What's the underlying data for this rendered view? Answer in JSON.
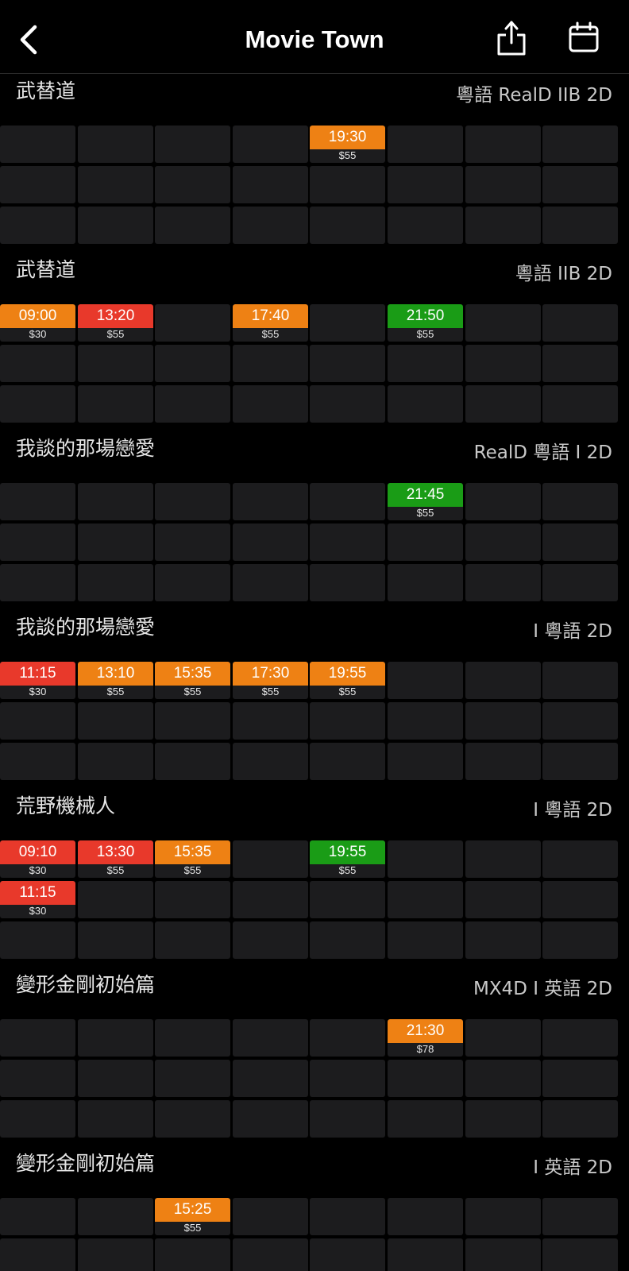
{
  "header": {
    "title": "Movie Town",
    "back_icon": "chevron-left-icon",
    "share_icon": "share-icon",
    "calendar_icon": "calendar-icon"
  },
  "colors": {
    "background": "#000000",
    "cell": "#1c1c1e",
    "orange": "#ee8114",
    "red": "#e8392b",
    "green": "#1a9c16"
  },
  "sections": [
    {
      "title": "武替道",
      "tags": "粵語 RealD IIB 2D",
      "showtimes": [
        {
          "time": "19:30",
          "price": "$55",
          "color": "orange",
          "row": 0,
          "col": 4
        }
      ]
    },
    {
      "title": "武替道",
      "tags": "粵語 IIB 2D",
      "showtimes": [
        {
          "time": "09:00",
          "price": "$30",
          "color": "orange",
          "row": 0,
          "col": 0
        },
        {
          "time": "13:20",
          "price": "$55",
          "color": "red",
          "row": 0,
          "col": 1
        },
        {
          "time": "17:40",
          "price": "$55",
          "color": "orange",
          "row": 0,
          "col": 3
        },
        {
          "time": "21:50",
          "price": "$55",
          "color": "green",
          "row": 0,
          "col": 5
        }
      ]
    },
    {
      "title": "我談的那場戀愛",
      "tags": "RealD 粵語 I 2D",
      "showtimes": [
        {
          "time": "21:45",
          "price": "$55",
          "color": "green",
          "row": 0,
          "col": 5
        }
      ]
    },
    {
      "title": "我談的那場戀愛",
      "tags": "I 粵語 2D",
      "showtimes": [
        {
          "time": "11:15",
          "price": "$30",
          "color": "red",
          "row": 0,
          "col": 0
        },
        {
          "time": "13:10",
          "price": "$55",
          "color": "orange",
          "row": 0,
          "col": 1
        },
        {
          "time": "15:35",
          "price": "$55",
          "color": "orange",
          "row": 0,
          "col": 2
        },
        {
          "time": "17:30",
          "price": "$55",
          "color": "orange",
          "row": 0,
          "col": 3
        },
        {
          "time": "19:55",
          "price": "$55",
          "color": "orange",
          "row": 0,
          "col": 4
        }
      ]
    },
    {
      "title": "荒野機械人",
      "tags": "I 粵語 2D",
      "showtimes": [
        {
          "time": "09:10",
          "price": "$30",
          "color": "red",
          "row": 0,
          "col": 0
        },
        {
          "time": "13:30",
          "price": "$55",
          "color": "red",
          "row": 0,
          "col": 1
        },
        {
          "time": "15:35",
          "price": "$55",
          "color": "orange",
          "row": 0,
          "col": 2
        },
        {
          "time": "19:55",
          "price": "$55",
          "color": "green",
          "row": 0,
          "col": 4
        },
        {
          "time": "11:15",
          "price": "$30",
          "color": "red",
          "row": 1,
          "col": 0
        }
      ]
    },
    {
      "title": "變形金剛初始篇",
      "tags": "MX4D I 英語 2D",
      "showtimes": [
        {
          "time": "21:30",
          "price": "$78",
          "color": "orange",
          "row": 0,
          "col": 5
        }
      ]
    },
    {
      "title": "變形金剛初始篇",
      "tags": "I 英語 2D",
      "showtimes": [
        {
          "time": "15:25",
          "price": "$55",
          "color": "orange",
          "row": 0,
          "col": 2
        }
      ]
    }
  ]
}
